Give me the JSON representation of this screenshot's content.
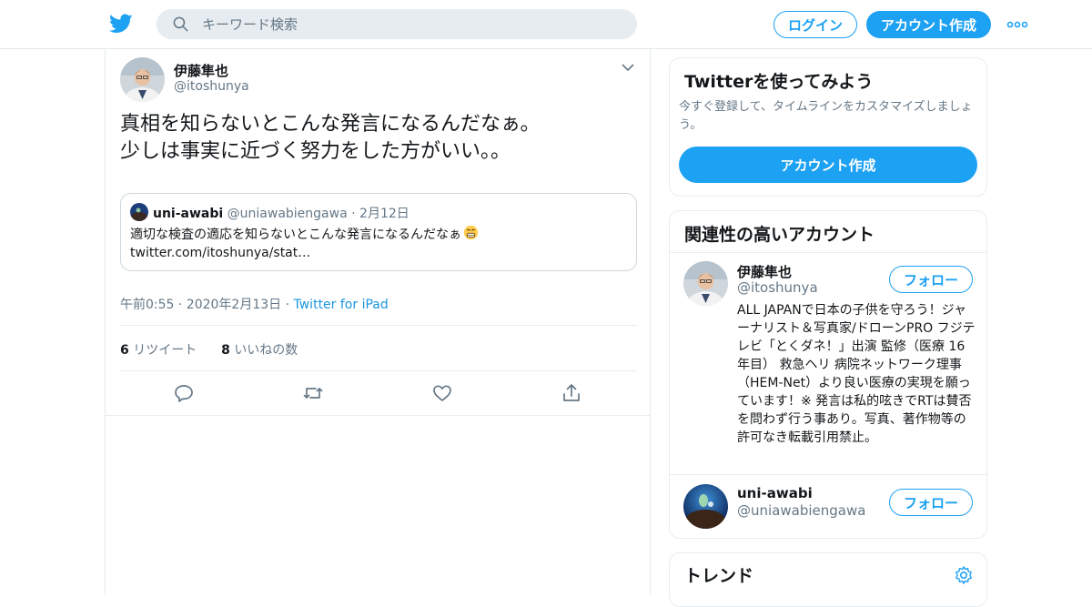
{
  "header": {
    "search_placeholder": "キーワード検索",
    "login_label": "ログイン",
    "signup_label": "アカウント作成"
  },
  "tweet": {
    "author_name": "伊藤隼也",
    "author_handle": "@itoshunya",
    "text_lines": [
      "真相を知らないとこんな発言になるんだなぁ。",
      "少しは事実に近づく努力をした方がいい。。"
    ],
    "quote": {
      "name": "uni-awabi",
      "handle": "@uniawabiengawa",
      "separator": "·",
      "date": "2月12日",
      "text": "適切な検査の適応を知らないとこんな発言になるんだなぁ",
      "link": "twitter.com/itoshunya/stat…"
    },
    "meta": "午前0:55 · 2020年2月13日 · ",
    "source": "Twitter for iPad",
    "retweet_count": "6",
    "retweet_label": "リツイート",
    "like_count": "8",
    "like_label": "いいねの数"
  },
  "sidebar": {
    "signup_card": {
      "title": "Twitterを使ってみよう",
      "description": "今すぐ登録して、タイムラインをカスタマイズしましょう。",
      "button": "アカウント作成"
    },
    "related": {
      "title": "関連性の高いアカウント",
      "accounts": [
        {
          "name": "伊藤隼也",
          "handle": "@itoshunya",
          "follow_label": "フォロー",
          "bio": "ALL JAPANで日本の子供を守ろう！ジャーナリスト＆写真家/ドローンPRO フジテレビ「とくダネ！」出演 監修（医療 16年目） 救急ヘリ 病院ネットワーク理事（HEM-Net）より良い医療の実現を願っています！※ 発言は私的呟きでRTは賛否を問わず行う事あり。写真、著作物等の許可なき転載引用禁止。"
        },
        {
          "name": "uni-awabi",
          "handle": "@uniawabiengawa",
          "follow_label": "フォロー"
        }
      ]
    },
    "trends": {
      "title": "トレンド"
    }
  },
  "colors": {
    "accent": "#1da1f2",
    "link": "#1b95e0",
    "muted": "#657786",
    "border": "#e6ecf0"
  },
  "icons": [
    "twitter-logo-icon",
    "search-icon",
    "more-dots-icon",
    "chevron-down-icon",
    "reply-icon",
    "retweet-icon",
    "like-icon",
    "share-icon",
    "gear-icon",
    "grimace-emoji-icon"
  ]
}
